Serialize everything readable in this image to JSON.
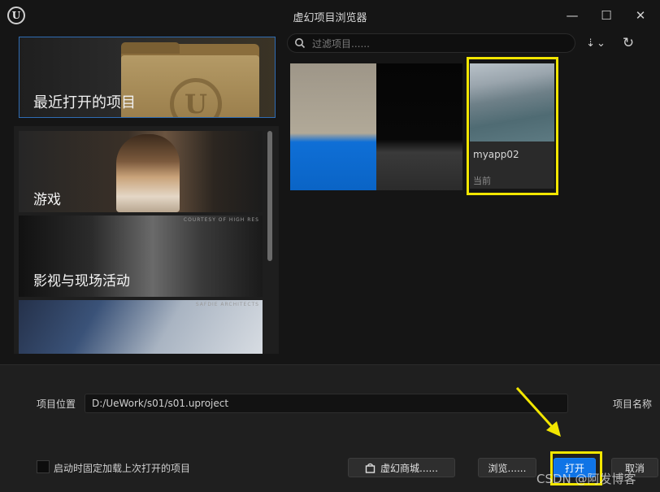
{
  "window": {
    "title": "虚幻项目浏览器",
    "minimize_glyph": "—",
    "maximize_glyph": "☐",
    "close_glyph": "✕"
  },
  "recent": {
    "label": "最近打开的项目"
  },
  "categories": [
    {
      "label": "游戏",
      "credit": ""
    },
    {
      "label": "影视与现场活动",
      "credit": "COURTESY OF HIGH RES"
    },
    {
      "label": "",
      "credit": "SAFDIE ARCHITECTS"
    }
  ],
  "search": {
    "placeholder": "过滤项目......"
  },
  "toolbar": {
    "sort_glyph": "⇣",
    "chevron_glyph": "⌄",
    "refresh_glyph": "↻"
  },
  "projects": [
    {
      "name": "",
      "status": ""
    },
    {
      "name": "",
      "status": ""
    },
    {
      "name": "myapp02",
      "status": "当前"
    }
  ],
  "location": {
    "label": "项目位置",
    "value": "D:/UeWork/s01/s01.uproject"
  },
  "project_name_label": "项目名称",
  "pin_option": {
    "label": "启动时固定加载上次打开的项目"
  },
  "buttons": {
    "store": "虚幻商城......",
    "browse": "浏览......",
    "open": "打开",
    "cancel": "取消"
  },
  "watermark": "CSDN @阿发博客",
  "colors": {
    "accent": "#0f74e6",
    "highlight": "#f2e600",
    "background": "#151515"
  }
}
